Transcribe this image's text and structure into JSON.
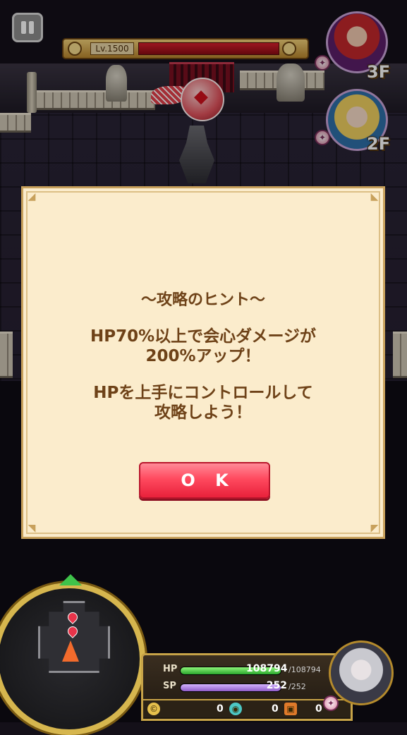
{
  "boss": {
    "level_label": "Lv.1500",
    "hp_fraction": 1.0
  },
  "party": [
    {
      "floor_label": "3F"
    },
    {
      "floor_label": "2F"
    }
  ],
  "dialog": {
    "title": "〜攻略のヒント〜",
    "lines": [
      "HP70%以上で会心ダメージが",
      "200%アップ！",
      "HPを上手にコントロールして",
      "攻略しよう！"
    ],
    "ok_label": "O K"
  },
  "status": {
    "hp": {
      "label": "HP",
      "current": "108794",
      "max": "/108794"
    },
    "sp": {
      "label": "SP",
      "current": "252",
      "max": "/252"
    },
    "items": [
      {
        "icon": "coin-icon",
        "count": "0"
      },
      {
        "icon": "soul-icon",
        "count": "0"
      },
      {
        "icon": "chest-icon",
        "count": "0"
      }
    ]
  },
  "colors": {
    "ok_button": "#ff4a5f",
    "dialog_bg": "#fbeccc",
    "dialog_text": "#6e4218",
    "hp_bar": "#2aa52c",
    "sp_bar": "#8e5cc8"
  }
}
